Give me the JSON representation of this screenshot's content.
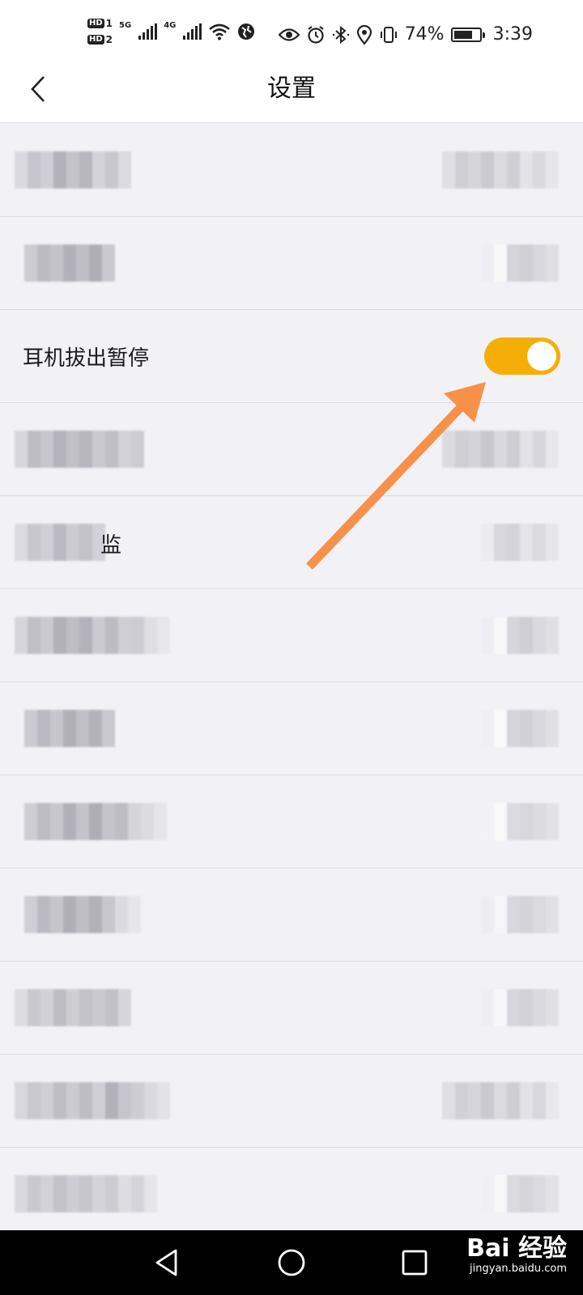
{
  "status_bar": {
    "hd1": "HD",
    "hd1_sub": "1",
    "hd2": "HD",
    "hd2_sub": "2",
    "network1": "5G",
    "network2": "4G",
    "battery_percent": "74%",
    "battery_level": 0.74,
    "time": "3:39",
    "icons": [
      "eye-icon",
      "alarm-icon",
      "bluetooth-icon",
      "location-icon",
      "vibrate-icon"
    ]
  },
  "header": {
    "title": "设置",
    "back_icon": "chevron-left-icon"
  },
  "settings": {
    "highlighted_label": "耳机拔出暂停",
    "highlighted_toggle_on": true,
    "partial_label_char": "监"
  },
  "colors": {
    "toggle_on": "#f5ae07",
    "arrow": "#f7914a",
    "background": "#f2f1f6"
  },
  "nav_bar": {
    "icons": [
      "back-triangle-icon",
      "home-circle-icon",
      "recents-square-icon"
    ]
  },
  "watermark": {
    "logo_text": "Bai  经验",
    "url": "jingyan.baidu.com"
  }
}
